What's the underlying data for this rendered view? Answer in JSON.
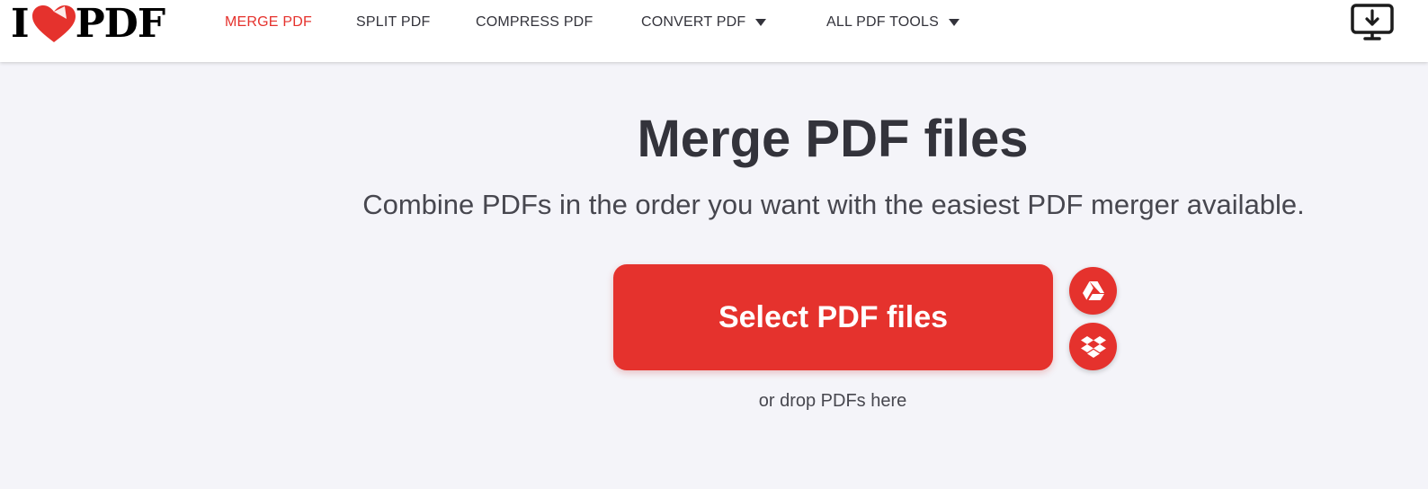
{
  "header": {
    "logo": {
      "left_text": "I",
      "right_text": "PDF",
      "heart_color": "#e5322d"
    },
    "nav": [
      {
        "label": "MERGE PDF",
        "active": true,
        "dropdown": false
      },
      {
        "label": "SPLIT PDF",
        "active": false,
        "dropdown": false
      },
      {
        "label": "COMPRESS PDF",
        "active": false,
        "dropdown": false
      },
      {
        "label": "CONVERT PDF",
        "active": false,
        "dropdown": true
      },
      {
        "label": "ALL PDF TOOLS",
        "active": false,
        "dropdown": true
      }
    ],
    "desktop_app_icon": "desktop-download-icon"
  },
  "main": {
    "title": "Merge PDF files",
    "subtitle": "Combine PDFs in the order you want with the easiest PDF merger available.",
    "select_button_label": "Select PDF files",
    "cloud_buttons": [
      {
        "icon": "google-drive-icon"
      },
      {
        "icon": "dropbox-icon"
      }
    ],
    "drop_hint": "or drop PDFs here"
  },
  "colors": {
    "accent": "#e5322d",
    "background": "#f4f4f9",
    "text": "#33333b"
  }
}
